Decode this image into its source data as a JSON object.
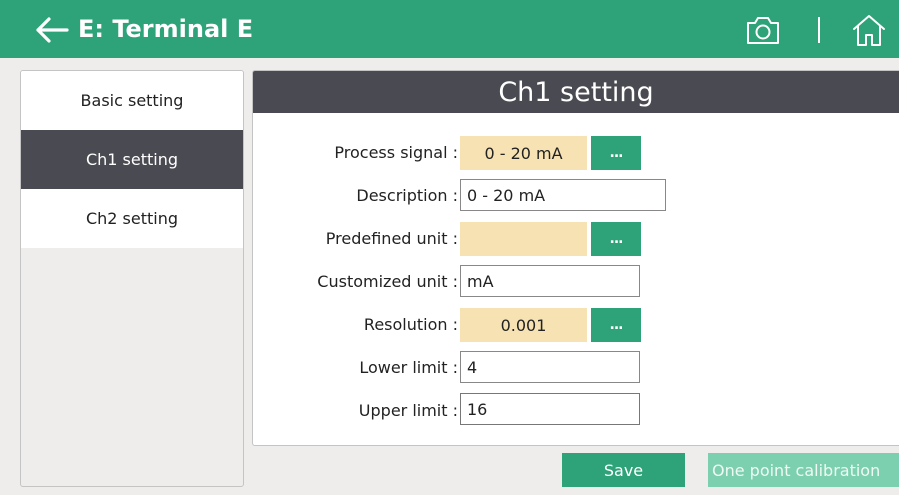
{
  "header": {
    "back_icon": "arrow-left-icon",
    "title": "E: Terminal E",
    "camera_icon": "camera-icon",
    "home_icon": "home-icon",
    "color": "#2ea37a"
  },
  "sidebar": {
    "items": [
      {
        "label": "Basic setting",
        "active": false
      },
      {
        "label": "Ch1 setting",
        "active": true
      },
      {
        "label": "Ch2 setting",
        "active": false
      }
    ]
  },
  "panel": {
    "title": "Ch1 setting",
    "fields": {
      "process_signal": {
        "label": "Process signal :",
        "value": "0 - 20 mA",
        "button": "..."
      },
      "description": {
        "label": "Description :",
        "value": "0 - 20 mA"
      },
      "predefined_unit": {
        "label": "Predefined unit :",
        "value": "",
        "button": "..."
      },
      "customized_unit": {
        "label": "Customized unit :",
        "value": "mA"
      },
      "resolution": {
        "label": "Resolution :",
        "value": "0.001",
        "button": "..."
      },
      "lower_limit": {
        "label": "Lower limit :",
        "value": "4"
      },
      "upper_limit": {
        "label": "Upper limit :",
        "value": "16"
      }
    }
  },
  "footer": {
    "save_label": "Save",
    "calibration_label": "One point calibration"
  },
  "colors": {
    "accent": "#2ea37a",
    "accent_disabled": "#7cd0b0",
    "selection_box": "#f7e2b3",
    "dark": "#4a4a52"
  }
}
